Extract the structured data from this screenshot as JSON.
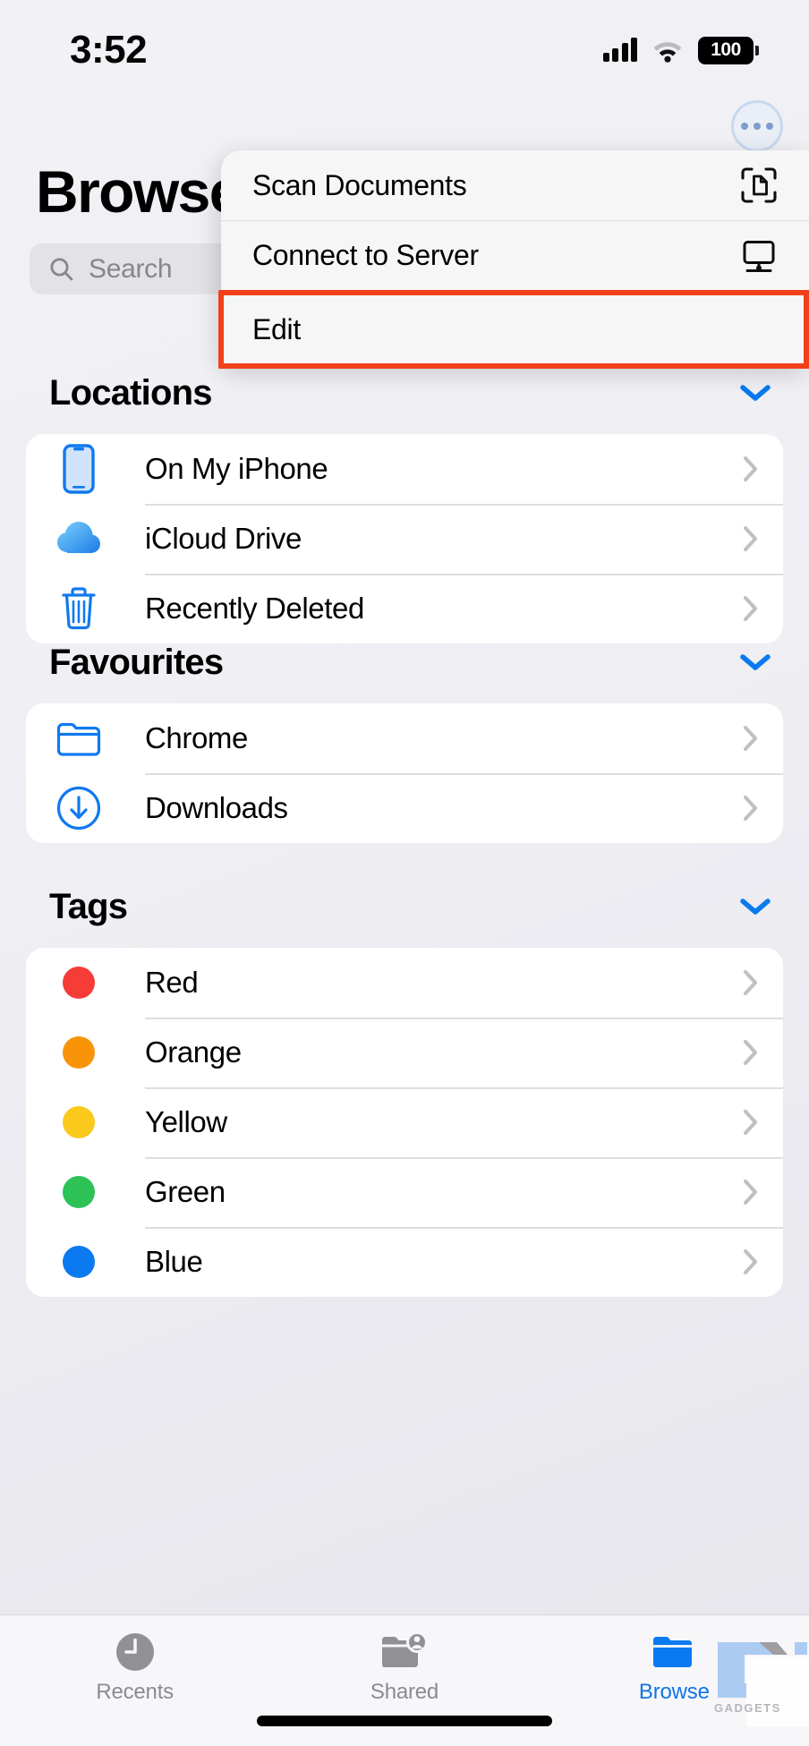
{
  "status_bar": {
    "time": "3:52",
    "battery_level": "100",
    "cellular_icon": "cellular-signal-icon",
    "wifi_icon": "wifi-icon",
    "battery_icon": "battery-icon"
  },
  "header": {
    "title": "Browse",
    "more_button_icon": "ellipsis-circle-icon"
  },
  "search": {
    "placeholder": "Search",
    "icon": "search-icon"
  },
  "context_menu": {
    "items": [
      {
        "label": "Scan Documents",
        "icon": "scan-documents-icon",
        "highlighted": false
      },
      {
        "label": "Connect to Server",
        "icon": "connect-to-server-icon",
        "highlighted": false
      },
      {
        "label": "Edit",
        "icon": "",
        "highlighted": true
      }
    ],
    "highlight_color": "#f0411a"
  },
  "sections": [
    {
      "title": "Locations",
      "collapse_icon": "chevron-down-icon",
      "rows": [
        {
          "label": "On My iPhone",
          "icon": "iphone-icon",
          "accessory": "chevron-right-icon"
        },
        {
          "label": "iCloud Drive",
          "icon": "icloud-drive-icon",
          "accessory": "chevron-right-icon"
        },
        {
          "label": "Recently Deleted",
          "icon": "trash-icon",
          "accessory": "chevron-right-icon"
        }
      ]
    },
    {
      "title": "Favourites",
      "collapse_icon": "chevron-down-icon",
      "rows": [
        {
          "label": "Chrome",
          "icon": "folder-icon",
          "accessory": "chevron-right-icon"
        },
        {
          "label": "Downloads",
          "icon": "downloads-circle-icon",
          "accessory": "chevron-right-icon"
        }
      ]
    },
    {
      "title": "Tags",
      "collapse_icon": "chevron-down-icon",
      "rows": [
        {
          "label": "Red",
          "icon": "tag-dot-icon",
          "color": "#f63c36",
          "accessory": "chevron-right-icon"
        },
        {
          "label": "Orange",
          "icon": "tag-dot-icon",
          "color": "#f99409",
          "accessory": "chevron-right-icon"
        },
        {
          "label": "Yellow",
          "icon": "tag-dot-icon",
          "color": "#fbc91b",
          "accessory": "chevron-right-icon"
        },
        {
          "label": "Green",
          "icon": "tag-dot-icon",
          "color": "#2cc255",
          "accessory": "chevron-right-icon"
        },
        {
          "label": "Blue",
          "icon": "tag-dot-icon",
          "color": "#0b79ef",
          "accessory": "chevron-right-icon"
        }
      ]
    }
  ],
  "tab_bar": {
    "tabs": [
      {
        "label": "Recents",
        "icon": "clock-icon",
        "active": false
      },
      {
        "label": "Shared",
        "icon": "shared-folder-icon",
        "active": false
      },
      {
        "label": "Browse",
        "icon": "folder-filled-icon",
        "active": true
      }
    ],
    "active_color": "#1274e8",
    "inactive_color": "#8b8b90"
  },
  "watermark": {
    "text": "GADGETS"
  }
}
